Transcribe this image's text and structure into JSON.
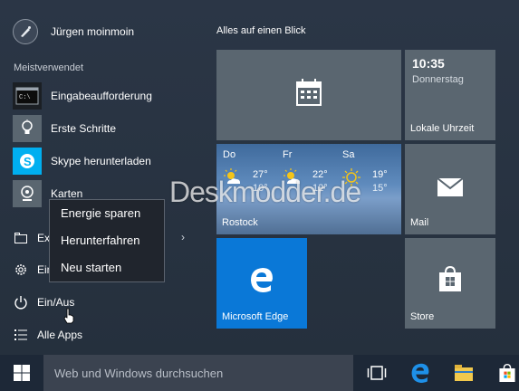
{
  "start_menu": {
    "user_name": "Jürgen moinmoin",
    "section_label": "Meistverwendet",
    "apps": [
      {
        "label": "Eingabeaufforderung",
        "icon": "command-prompt-icon"
      },
      {
        "label": "Erste Schritte",
        "icon": "lightbulb-icon"
      },
      {
        "label": "Skype herunterladen",
        "icon": "skype-icon"
      },
      {
        "label": "Karten",
        "icon": "maps-icon"
      }
    ],
    "nav": {
      "explorer_label": "Exp",
      "settings_label": "Ein",
      "power_label": "Ein/Aus",
      "all_apps_label": "Alle Apps"
    },
    "power_menu": {
      "items": [
        "Energie sparen",
        "Herunterfahren",
        "Neu starten"
      ]
    }
  },
  "tiles": {
    "group_title": "Alles auf einen Blick",
    "clock": {
      "time": "10:35",
      "day": "Donnerstag",
      "label": "Lokale Uhrzeit"
    },
    "weather": {
      "label": "Rostock",
      "days": [
        {
          "day": "Do",
          "high": "27°",
          "low": "10°"
        },
        {
          "day": "Fr",
          "high": "22°",
          "low": "12°"
        },
        {
          "day": "Sa",
          "high": "19°",
          "low": "15°"
        }
      ]
    },
    "mail": {
      "label": "Mail"
    },
    "edge": {
      "label": "Microsoft Edge"
    },
    "store": {
      "label": "Store"
    }
  },
  "watermark": "Deskmodder.de",
  "taskbar": {
    "search_placeholder": "Web und Windows durchsuchen"
  },
  "colors": {
    "start_bg": "#2b3646",
    "tile_grey": "#5a6670",
    "edge_blue": "#0a78d7",
    "taskbar": "#1d2837",
    "search_box": "#3b4350"
  }
}
